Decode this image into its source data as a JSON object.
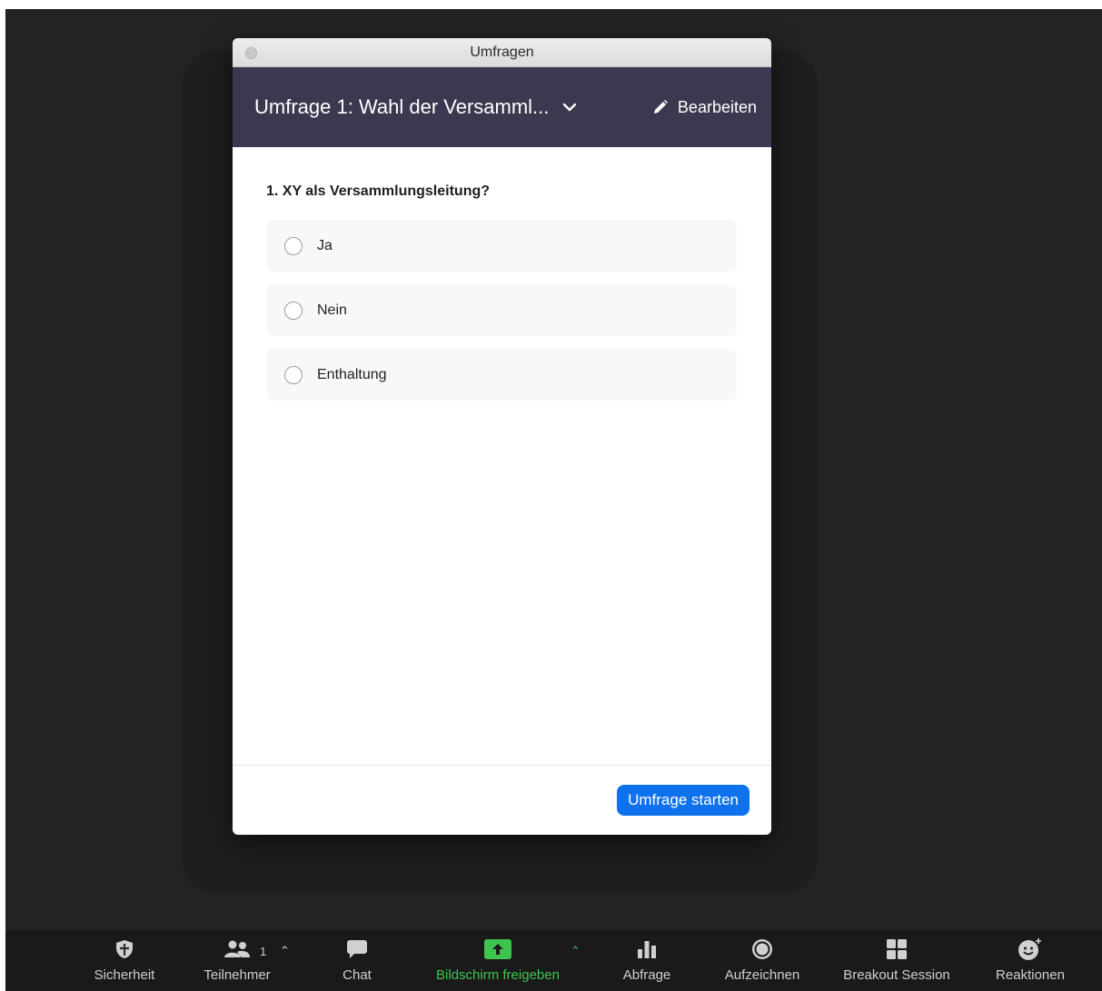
{
  "window": {
    "title": "Umfragen"
  },
  "poll": {
    "selected": "Umfrage 1: Wahl der Versamml...",
    "edit_label": "Bearbeiten",
    "question": "1. XY als Versammlungsleitung?",
    "options": [
      {
        "label": "Ja",
        "selected": false
      },
      {
        "label": "Nein",
        "selected": false
      },
      {
        "label": "Enthaltung",
        "selected": false
      }
    ],
    "start_label": "Umfrage starten"
  },
  "toolbar": {
    "items": [
      {
        "label": "Sicherheit",
        "icon": "shield-icon"
      },
      {
        "label": "Teilnehmer",
        "icon": "participants-icon",
        "count": "1"
      },
      {
        "label": "Chat",
        "icon": "chat-icon"
      },
      {
        "label": "Bildschirm freigeben",
        "icon": "share-screen-icon"
      },
      {
        "label": "Abfrage",
        "icon": "poll-icon"
      },
      {
        "label": "Aufzeichnen",
        "icon": "record-icon"
      },
      {
        "label": "Breakout Session",
        "icon": "breakout-icon"
      },
      {
        "label": "Reaktionen",
        "icon": "reaction-icon"
      }
    ]
  },
  "colors": {
    "header": "#3b3950",
    "accent_blue": "#0e72ed",
    "share_green": "#3ec54f",
    "toolbar_bg": "#1a1a1a"
  }
}
